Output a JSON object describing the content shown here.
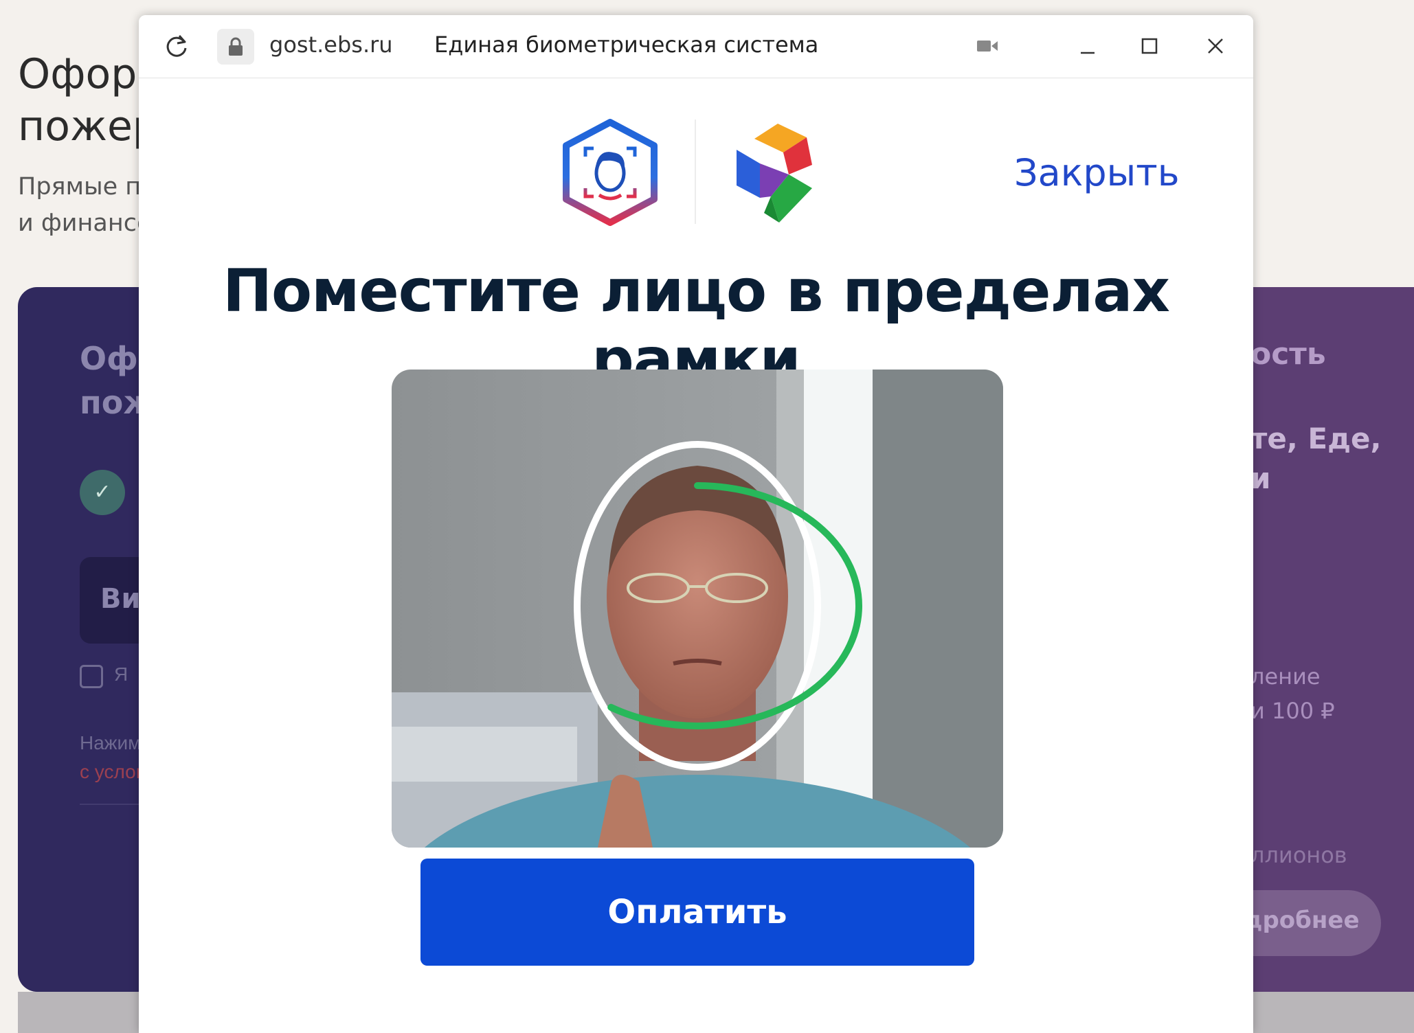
{
  "background": {
    "title": "Оформ\nпожер",
    "subtitle": "Прямые п\nи финансо",
    "left_card": {
      "title": "Оф\nпож",
      "button_label": "Ви",
      "checkbox_label": "Я",
      "terms_text": "Нажим",
      "terms_link": "с услов"
    },
    "right_card": {
      "title": "ость",
      "text": "те, Еде,\nи",
      "info": "ление\nи 100 ₽",
      "stat": "ллионов",
      "more_label": "дробнее"
    }
  },
  "window": {
    "url": "gost.ebs.ru",
    "title": "Единая биометрическая система",
    "icons": [
      "reload-icon",
      "lock-icon",
      "camera-icon",
      "minimize-icon",
      "maximize-icon",
      "close-icon"
    ]
  },
  "dialog": {
    "close_label": "Закрыть",
    "heading": "Поместите лицо в пределах рамки",
    "face_frame_progress": 0.6,
    "pay_label": "Оплатить"
  },
  "colors": {
    "accent_blue": "#0c4ad6",
    "link_blue": "#2248c9",
    "frame_green": "#27b85a",
    "heading": "#0b1f35"
  }
}
